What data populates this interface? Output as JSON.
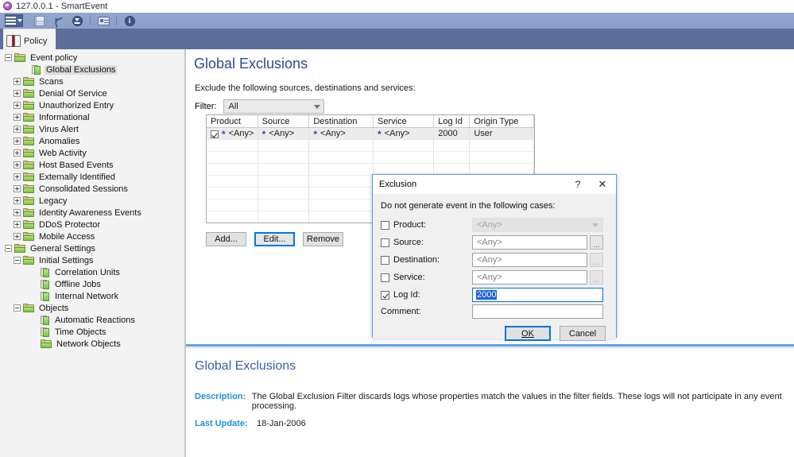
{
  "window": {
    "title": "127.0.0.1 - SmartEvent",
    "app_icon": "smartevent-app-icon"
  },
  "quick_access_toolbar": {
    "items": [
      {
        "name": "main-menu-button",
        "icon": "hamburger-menu-icon"
      },
      {
        "name": "save-button",
        "icon": "save-disk-icon"
      },
      {
        "name": "undo-button",
        "icon": "undo-arrow-icon"
      },
      {
        "name": "install-policy-button",
        "icon": "download-circle-icon"
      },
      {
        "name": "view-button",
        "icon": "id-card-icon"
      },
      {
        "name": "about-button",
        "icon": "info-circle-icon"
      }
    ]
  },
  "ribbon": {
    "tabs": [
      {
        "label": "Policy",
        "icon": "book-icon",
        "active": true
      }
    ]
  },
  "sidebar": {
    "collapse_icon": "collapse-left-chevron-icon",
    "items": [
      {
        "label": "Event policy",
        "indent": 0,
        "icon": "folder",
        "expander": "minus",
        "selected": false
      },
      {
        "label": "Global Exclusions",
        "indent": 2,
        "icon": "page",
        "expander": "none",
        "selected": true
      },
      {
        "label": "Scans",
        "indent": 1,
        "icon": "folder",
        "expander": "plus",
        "selected": false
      },
      {
        "label": "Denial Of Service",
        "indent": 1,
        "icon": "folder",
        "expander": "plus",
        "selected": false
      },
      {
        "label": "Unauthorized Entry",
        "indent": 1,
        "icon": "folder",
        "expander": "plus",
        "selected": false
      },
      {
        "label": "Informational",
        "indent": 1,
        "icon": "folder",
        "expander": "plus",
        "selected": false
      },
      {
        "label": "Virus Alert",
        "indent": 1,
        "icon": "folder",
        "expander": "plus",
        "selected": false
      },
      {
        "label": "Anomalies",
        "indent": 1,
        "icon": "folder",
        "expander": "plus",
        "selected": false
      },
      {
        "label": "Web Activity",
        "indent": 1,
        "icon": "folder",
        "expander": "plus",
        "selected": false
      },
      {
        "label": "Host Based Events",
        "indent": 1,
        "icon": "folder",
        "expander": "plus",
        "selected": false
      },
      {
        "label": "Externally Identified",
        "indent": 1,
        "icon": "folder",
        "expander": "plus",
        "selected": false
      },
      {
        "label": "Consolidated Sessions",
        "indent": 1,
        "icon": "folder",
        "expander": "plus",
        "selected": false
      },
      {
        "label": "Legacy",
        "indent": 1,
        "icon": "folder",
        "expander": "plus",
        "selected": false
      },
      {
        "label": "Identity Awareness Events",
        "indent": 1,
        "icon": "folder",
        "expander": "plus",
        "selected": false
      },
      {
        "label": "DDoS Protector",
        "indent": 1,
        "icon": "folder",
        "expander": "plus",
        "selected": false
      },
      {
        "label": "Mobile Access",
        "indent": 1,
        "icon": "folder",
        "expander": "plus",
        "selected": false
      },
      {
        "label": "General Settings",
        "indent": 0,
        "icon": "folder",
        "expander": "minus",
        "selected": false
      },
      {
        "label": "Initial Settings",
        "indent": 1,
        "icon": "folder",
        "expander": "minus",
        "selected": false
      },
      {
        "label": "Correlation Units",
        "indent": 3,
        "icon": "page",
        "expander": "none",
        "selected": false
      },
      {
        "label": "Offline Jobs",
        "indent": 3,
        "icon": "page",
        "expander": "none",
        "selected": false
      },
      {
        "label": "Internal Network",
        "indent": 3,
        "icon": "page",
        "expander": "none",
        "selected": false
      },
      {
        "label": "Objects",
        "indent": 1,
        "icon": "folder",
        "expander": "minus",
        "selected": false
      },
      {
        "label": "Automatic Reactions",
        "indent": 3,
        "icon": "page",
        "expander": "none",
        "selected": false
      },
      {
        "label": "Time Objects",
        "indent": 3,
        "icon": "page",
        "expander": "none",
        "selected": false
      },
      {
        "label": "Network Objects",
        "indent": 3,
        "icon": "folder",
        "expander": "none",
        "selected": false
      }
    ]
  },
  "main": {
    "title": "Global Exclusions",
    "instruction": "Exclude the following sources, destinations and services:",
    "filter": {
      "label": "Filter:",
      "value": "All",
      "options": [
        "All"
      ],
      "chevron_icon": "chevron-down-icon"
    },
    "table": {
      "columns": [
        "Product",
        "Source",
        "Destination",
        "Service",
        "Log Id",
        "Origin Type"
      ],
      "rows": [
        {
          "checked": true,
          "product": "<Any>",
          "source": "<Any>",
          "destination": "<Any>",
          "service": "<Any>",
          "log_id": "2000",
          "origin_type": "User"
        }
      ],
      "empty_row_count": 7,
      "star_glyph": "*"
    },
    "buttons": {
      "add": "Add...",
      "edit": "Edit...",
      "remove": "Remove"
    }
  },
  "description_pane": {
    "title": "Global Exclusions",
    "fields": [
      {
        "key": "Description:",
        "value": "The Global Exclusion Filter discards logs whose properties match the values in the filter fields. These logs will not participate in any event processing."
      },
      {
        "key": "Last Update:",
        "value": "18-Jan-2006"
      }
    ]
  },
  "dialog": {
    "title": "Exclusion",
    "help_glyph": "?",
    "close_glyph": "✕",
    "note": "Do not generate event in the following cases:",
    "fields": [
      {
        "label": "Product:",
        "checked": false,
        "value": "<Any>",
        "control": "combo",
        "enabled": false,
        "browse": false
      },
      {
        "label": "Source:",
        "checked": false,
        "value": "<Any>",
        "control": "text",
        "enabled": false,
        "browse": true
      },
      {
        "label": "Destination:",
        "checked": false,
        "value": "<Any>",
        "control": "text",
        "enabled": false,
        "browse": true
      },
      {
        "label": "Service:",
        "checked": false,
        "value": "<Any>",
        "control": "text",
        "enabled": false,
        "browse": true
      },
      {
        "label": "Log Id:",
        "checked": true,
        "value": "2000",
        "control": "active",
        "enabled": true,
        "browse": false
      }
    ],
    "comment": {
      "label": "Comment:",
      "value": "",
      "placeholder": ""
    },
    "buttons": {
      "ok": "OK",
      "cancel": "Cancel"
    }
  },
  "colors": {
    "accent_blue": "#0078d7",
    "title_blue": "#2d4b8e",
    "ribbon_blue": "#5c6e99",
    "qat_blue": "#8ea2cb",
    "link_blue": "#1f8fe0",
    "star_blue": "#2048d8",
    "selection_blue": "#1e5fd8"
  }
}
